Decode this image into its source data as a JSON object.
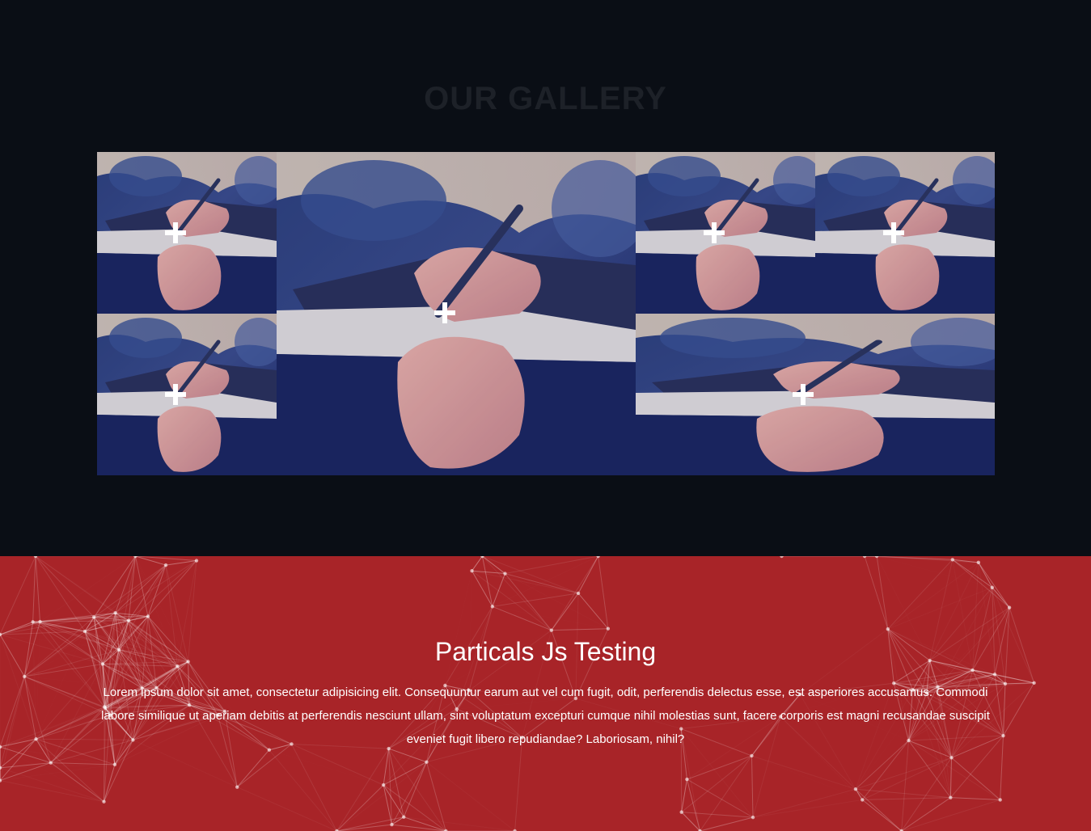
{
  "gallery": {
    "title": "OUR GALLERY",
    "items": [
      {
        "name": "gallery-item-1"
      },
      {
        "name": "gallery-item-2"
      },
      {
        "name": "gallery-item-3"
      },
      {
        "name": "gallery-item-4"
      },
      {
        "name": "gallery-item-5"
      },
      {
        "name": "gallery-item-6"
      }
    ]
  },
  "particles": {
    "title": "Particals Js Testing",
    "body": "Lorem ipsum dolor sit amet, consectetur adipisicing elit. Consequuntur earum aut vel cum fugit, odit, perferendis delectus esse, est asperiores accusamus. Commodi labore similique ut aperiam debitis at perferendis nesciunt ullam, sint voluptatum excepturi cumque nihil molestias sunt, facere corporis est magni recusandae suscipit eveniet fugit libero repudiandae? Laboriosam, nihil?"
  },
  "colors": {
    "gallery_bg": "#0a0e15",
    "title_color": "#1d2128",
    "particles_bg": "#a82428"
  }
}
